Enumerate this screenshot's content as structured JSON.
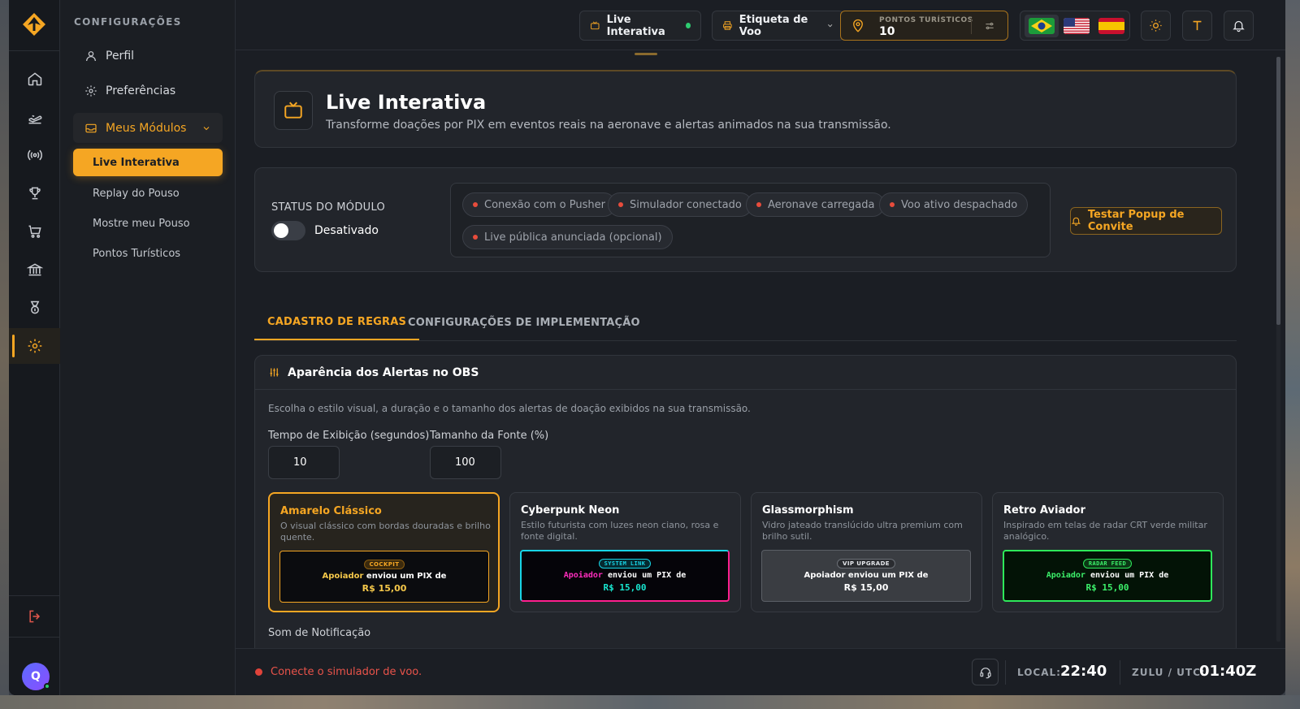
{
  "sidebar": {
    "title": "CONFIGURAÇÕES",
    "items": [
      {
        "label": "Perfil",
        "icon": "user-icon"
      },
      {
        "label": "Preferências",
        "icon": "gear-icon"
      }
    ],
    "group": {
      "label": "Meus Módulos",
      "icon": "inbox-icon"
    },
    "subitems": [
      {
        "label": "Live Interativa",
        "active": true
      },
      {
        "label": "Replay do Pouso"
      },
      {
        "label": "Mostre meu Pouso"
      },
      {
        "label": "Pontos Turísticos"
      }
    ]
  },
  "rail": {
    "icons": [
      "home-icon",
      "departure-icon",
      "broadcast-icon",
      "trophy-icon",
      "cart-icon",
      "bank-icon",
      "medal-icon",
      "gear-icon"
    ],
    "active": "gear-icon",
    "logout": "logout-icon",
    "avatar_initial": "Q"
  },
  "topbar": {
    "live_label": "Live Interativa",
    "tag_label": "Etiqueta de Voo",
    "points_label": "PONTOS TURÍSTICOS",
    "points_value": "10",
    "languages": [
      "pt-BR",
      "en-US",
      "es-ES"
    ],
    "selected_language": "pt-BR"
  },
  "hero": {
    "title": "Live Interativa",
    "subtitle": "Transforme doações por PIX em eventos reais na aeronave e alertas animados na sua transmissão."
  },
  "status": {
    "label": "STATUS DO MÓDULO",
    "state": "Desativado",
    "checks": [
      "Conexão com o Pusher",
      "Simulador conectado",
      "Aeronave carregada",
      "Voo ativo despachado",
      "Live pública anunciada (opcional)"
    ],
    "test_button": "Testar Popup de Convite"
  },
  "tabs": [
    {
      "label": "CADASTRO DE REGRAS",
      "active": true
    },
    {
      "label": "CONFIGURAÇÕES DE IMPLEMENTAÇÃO",
      "active": false
    }
  ],
  "appearance": {
    "title": "Aparência dos Alertas no OBS",
    "description": "Escolha o estilo visual, a duração e o tamanho dos alertas de doação exibidos na sua transmissão.",
    "duration_label": "Tempo de Exibição (segundos)",
    "duration_value": "10",
    "font_label": "Tamanho da Fonte (%)",
    "font_value": "100",
    "styles": [
      {
        "title": "Amarelo Clássico",
        "desc": "O visual clássico com bordas douradas e brilho quente.",
        "badge": "COCKPIT",
        "who": "Apoiador",
        "line": "enviou um PIX de",
        "amount": "R$ 15,00",
        "selected": true
      },
      {
        "title": "Cyberpunk Neon",
        "desc": "Estilo futurista com luzes neon ciano, rosa e fonte digital.",
        "badge": "SYSTEM LINK",
        "who": "Apoiador",
        "line": "enviou um PIX de",
        "amount": "R$ 15,00"
      },
      {
        "title": "Glassmorphism",
        "desc": "Vidro jateado translúcido ultra premium com brilho sutil.",
        "badge": "VIP UPGRADE",
        "who": "Apoiador",
        "line": "enviou um PIX de",
        "amount": "R$ 15,00"
      },
      {
        "title": "Retro Aviador",
        "desc": "Inspirado em telas de radar CRT verde militar analógico.",
        "badge": "RADAR FEED",
        "who": "Apoiador",
        "line": "enviou um PIX de",
        "amount": "R$ 15,00"
      }
    ],
    "sound_label": "Som de Notificação"
  },
  "footer": {
    "warning": "Conecte o simulador de voo.",
    "local_label": "LOCAL:",
    "local_time": "22:40",
    "zulu_label": "ZULU / UTC:",
    "zulu_time": "01:40Z"
  },
  "colors": {
    "accent": "#f5a623",
    "danger": "#e74c3c",
    "ok": "#2ecc71"
  }
}
